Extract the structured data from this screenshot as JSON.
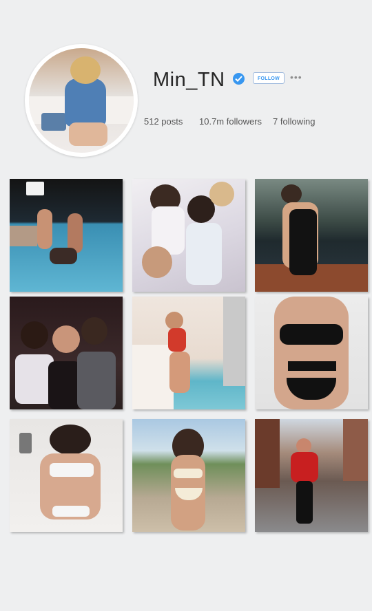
{
  "profile": {
    "username": "Min_TN",
    "follow_label": "FOLLOW",
    "more_label": "•••",
    "stats": {
      "posts": "512 posts",
      "followers": "10.7m followers",
      "following": "7 following"
    }
  },
  "colors": {
    "verified": "#3897f0",
    "background": "#eeeff0"
  },
  "posts": [
    {
      "subject": "pool party night"
    },
    {
      "subject": "group selfie"
    },
    {
      "subject": "black swimsuit on boat"
    },
    {
      "subject": "friends at party"
    },
    {
      "subject": "red swimsuit by pool"
    },
    {
      "subject": "black strappy bikini"
    },
    {
      "subject": "white lingerie on bed"
    },
    {
      "subject": "bikini on beach path"
    },
    {
      "subject": "red jacket city street"
    }
  ]
}
